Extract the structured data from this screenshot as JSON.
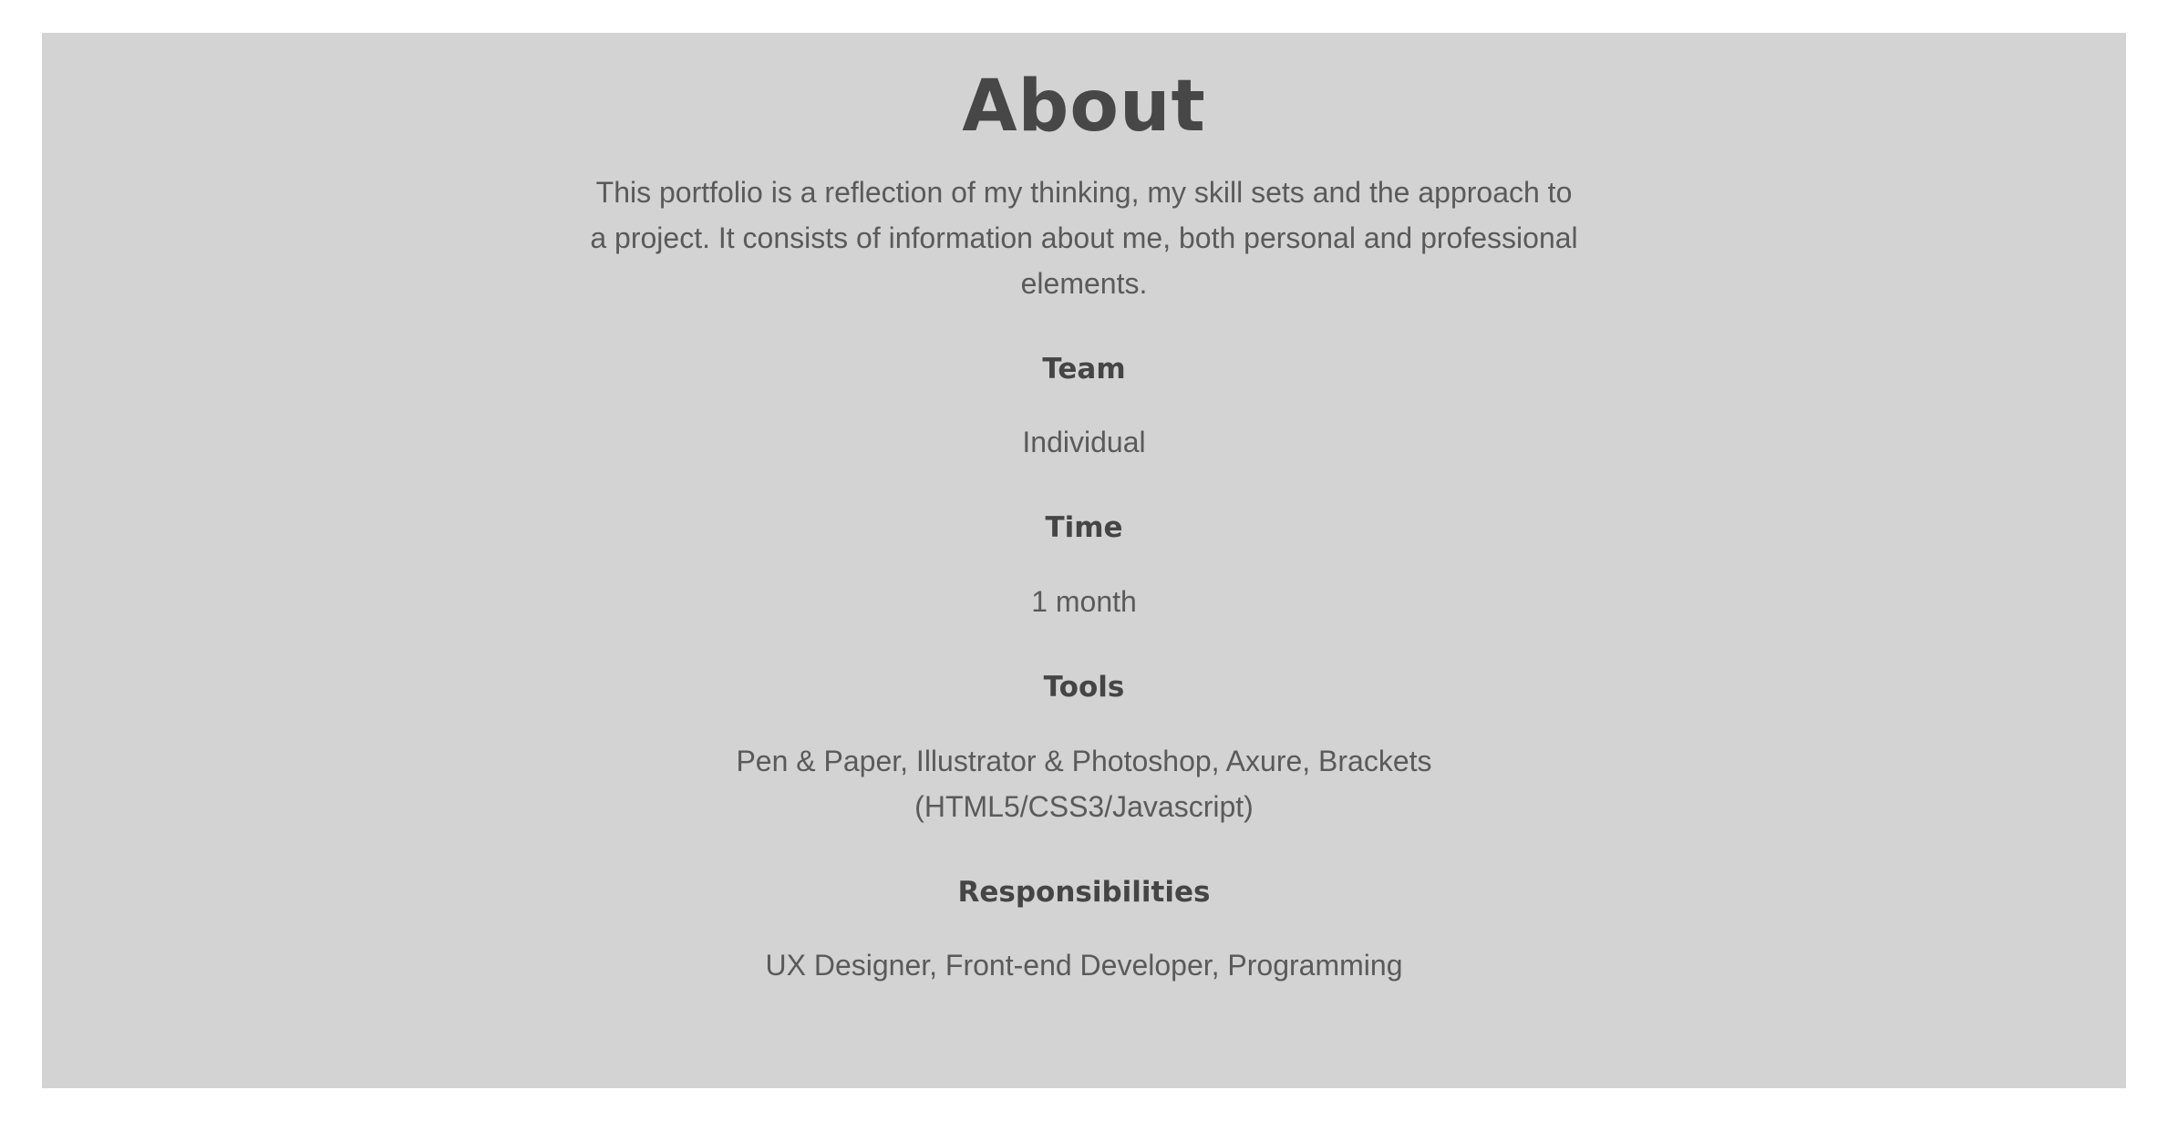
{
  "about": {
    "title": "About",
    "intro": "This portfolio is a reflection of my thinking, my skill sets and the approach to a project. It consists of information about me, both personal and professional elements.",
    "sections": [
      {
        "heading": "Team",
        "value": "Individual"
      },
      {
        "heading": "Time",
        "value": "1 month"
      },
      {
        "heading": "Tools",
        "value": "Pen & Paper, Illustrator & Photoshop, Axure, Brackets (HTML5/CSS3/Javascript)"
      },
      {
        "heading": "Responsibilities",
        "value": "UX Designer, Front-end Developer, Programming"
      }
    ]
  },
  "colors": {
    "panel_background": "#d3d3d3",
    "heading_text": "#474747",
    "body_text": "#5a5a5a",
    "page_background": "#ffffff"
  }
}
